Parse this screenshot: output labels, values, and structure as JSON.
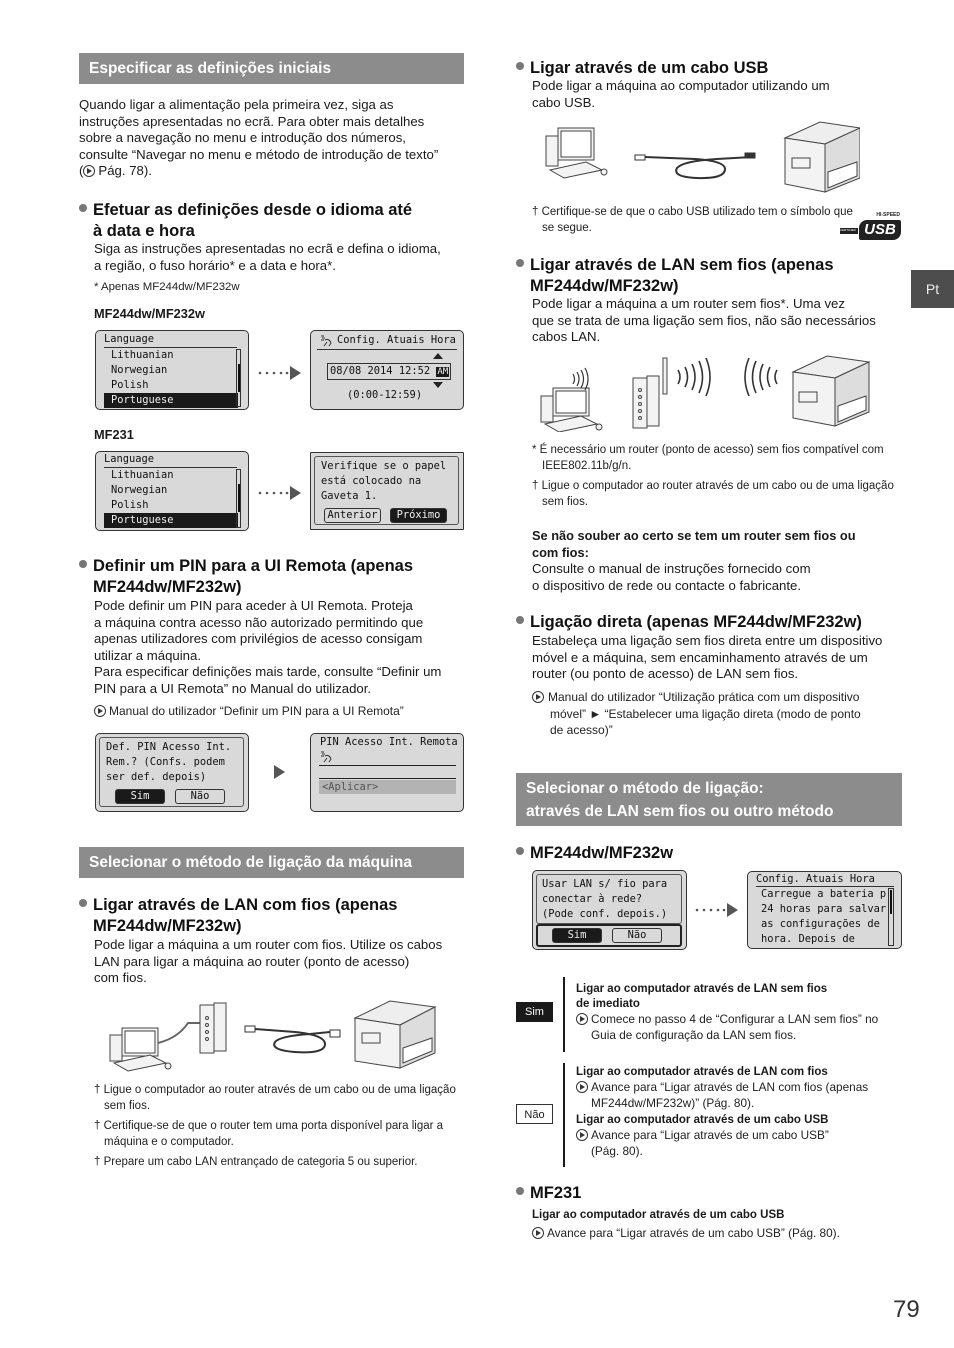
{
  "language_tab": "Pt",
  "page_number": "79",
  "left": {
    "section1": {
      "title": "Especificar as definições iniciais",
      "intro": [
        "Quando ligar a alimentação pela primeira vez, siga as",
        "instruções apresentadas no ecrã. Para obter mais detalhes",
        "sobre a navegação no menu e introdução dos números,",
        "consulte “Navegar no menu e método de introdução de texto”"
      ],
      "intro_ref": "Pág. 78).",
      "intro_ref_prefix": "(",
      "lang_heading": [
        "Efetuar as definições desde o idioma até",
        "à data e hora"
      ],
      "lang_body": [
        "Siga as instruções apresentadas no ecrã e defina o idioma,",
        "a região, o fuso horário* e a data e hora*."
      ],
      "lang_note": "* Apenas MF244dw/MF232w",
      "model_a": "MF244dw/MF232w",
      "model_b": "MF231",
      "lcd_language": {
        "title": "Language",
        "items": [
          "Lithuanian",
          "Norwegian",
          "Polish",
          "Portuguese"
        ],
        "selected": "Portuguese"
      },
      "lcd_time": {
        "title": "Config. Atuais Hora",
        "value": "08/08 2014 12:52",
        "ampm": "AM",
        "range": "(0:00-12:59)"
      },
      "lcd_paper": {
        "lines": [
          "Verifique se o papel",
          "está colocado na",
          "Gaveta 1."
        ],
        "btn_prev": "Anterior",
        "btn_next": "Próximo"
      },
      "pin_heading": [
        "Definir um PIN para a UI Remota (apenas",
        "MF244dw/MF232w)"
      ],
      "pin_body": [
        "Pode definir um PIN para aceder à UI Remota. Proteja",
        "a máquina contra acesso não autorizado permitindo que",
        "apenas utilizadores com privilégios de acesso consigam",
        "utilizar a máquina.",
        "Para especificar definições mais tarde, consulte “Definir um",
        "PIN para a UI Remota” no Manual do utilizador."
      ],
      "pin_ref": "Manual do utilizador “Definir um PIN para a UI Remota”",
      "lcd_pin_ask": {
        "lines": [
          "Def. PIN Acesso Int.",
          "Rem.? (Confs. podem",
          "ser def. depois)"
        ],
        "btn_yes": "Sim",
        "btn_no": "Não"
      },
      "lcd_pin_entry": {
        "title": "PIN Acesso Int. Remota",
        "apply": "<Aplicar>"
      }
    },
    "section2": {
      "title": "Selecionar o método de ligação da máquina",
      "wired_heading": [
        "Ligar através de LAN com fios (apenas",
        "MF244dw/MF232w)"
      ],
      "wired_body": [
        "Pode ligar a máquina a um router com fios. Utilize os cabos",
        "LAN para ligar a máquina ao router (ponto de acesso)",
        "com fios."
      ],
      "wired_notes": [
        "† Ligue o computador ao router através de um cabo ou de uma ligação sem fios.",
        "† Certifique-se de que o router tem uma porta disponível para ligar a máquina e o computador.",
        "† Prepare um cabo LAN entrançado de categoria 5 ou superior."
      ]
    }
  },
  "right": {
    "usb": {
      "heading": "Ligar através de um cabo USB",
      "body": [
        "Pode ligar a máquina ao computador utilizando um",
        "cabo USB."
      ],
      "note": "† Certifique-se de que o cabo USB utilizado tem o símbolo que se segue.",
      "logo_text": "USB",
      "logo_top": "HI-SPEED",
      "logo_side": "CERTIFIED"
    },
    "wireless": {
      "heading": [
        "Ligar através de LAN sem fios (apenas",
        "MF244dw/MF232w)"
      ],
      "body": [
        "Pode ligar a máquina a um router sem fios*. Uma vez",
        "que se trata de uma ligação sem fios, não são necessários",
        "cabos LAN."
      ],
      "notes": [
        "* É necessário um router (ponto de acesso) sem fios compatível com IEEE802.11b/g/n.",
        "† Ligue o computador ao router através de um cabo ou de uma ligação sem fios."
      ],
      "unsure_heading": [
        "Se não souber ao certo se tem um router sem fios ou",
        "com fios:"
      ],
      "unsure_body": [
        "Consulte o manual de instruções fornecido com",
        "o dispositivo de rede ou contacte o fabricante."
      ]
    },
    "direct": {
      "heading": "Ligação direta (apenas MF244dw/MF232w)",
      "body": [
        "Estabeleça uma ligação sem fios direta entre um dispositivo",
        "móvel e a máquina, sem encaminhamento através de um",
        "router (ou ponto de acesso) de LAN sem fios."
      ],
      "ref": [
        "Manual do utilizador “Utilização prática com um dispositivo",
        "móvel” ► “Estabelecer uma ligação direta (modo de ponto",
        "de acesso)”"
      ]
    },
    "section3": {
      "title": [
        "Selecionar o método de ligação:",
        "através de LAN sem fios ou outro método"
      ],
      "model_a": "MF244dw/MF232w",
      "lcd_wlan": {
        "lines": [
          "Usar LAN s/ fio para",
          "conectar à rede?",
          "(Pode conf. depois.)"
        ],
        "btn_yes": "Sim",
        "btn_no": "Não"
      },
      "lcd_battery": {
        "title": "Config. Atuais Hora",
        "lines": [
          "Carregue a bateria p",
          "24 horas para salvar",
          "as configurações de",
          "hora. Depois de"
        ]
      },
      "choice_yes": {
        "label": "Sim",
        "title": [
          "Ligar ao computador através de LAN sem fios",
          "de imediato"
        ],
        "ref": [
          "Comece no passo 4 de “Configurar a LAN sem fios” no",
          "Guia de configuração da LAN sem fios."
        ]
      },
      "choice_no": {
        "label": "Não",
        "title1": "Ligar ao computador através de LAN com fios",
        "ref1": [
          "Avance para “Ligar através de LAN com fios (apenas",
          "MF244dw/MF232w)” (Pág. 80)."
        ],
        "title2": "Ligar ao computador através de um cabo USB",
        "ref2": [
          "Avance para “Ligar através de um cabo USB”",
          "(Pág. 80)."
        ]
      },
      "model_b": "MF231",
      "mf231_title": "Ligar ao computador através de um cabo USB",
      "mf231_ref": "Avance para “Ligar através de um cabo USB” (Pág. 80)."
    }
  }
}
